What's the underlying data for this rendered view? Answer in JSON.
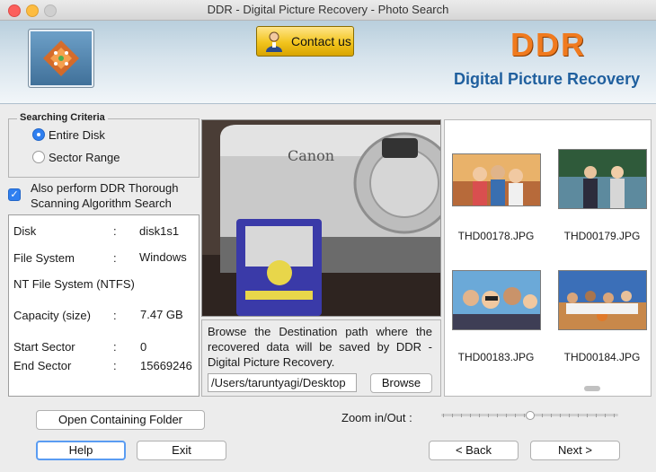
{
  "window": {
    "title": "DDR - Digital Picture Recovery - Photo Search"
  },
  "header": {
    "contact_label": "Contact us",
    "brand_title": "DDR",
    "brand_subtitle": "Digital Picture Recovery"
  },
  "criteria": {
    "legend": "Searching Criteria",
    "options": [
      {
        "label": "Entire Disk",
        "selected": true
      },
      {
        "label": "Sector Range",
        "selected": false
      }
    ]
  },
  "thorough": {
    "label_line1": "Also perform DDR Thorough",
    "label_line2": "Scanning Algorithm Search",
    "checked": true
  },
  "disk_info": {
    "disk_label": "Disk",
    "disk_value": "disk1s1",
    "fs_label": "File System",
    "fs_value": "Windows",
    "fs_full": "NT File System (NTFS)",
    "capacity_label": "Capacity (size)",
    "capacity_value": "7.47  GB",
    "start_label": "Start Sector",
    "start_value": "0",
    "end_label": "End Sector",
    "end_value": "15669246",
    "sep": ":"
  },
  "destination": {
    "instructions": "Browse the Destination path where the recovered data will be saved by DDR - Digital Picture Recovery.",
    "path": "/Users/taruntyagi/Desktop",
    "browse_label": "Browse"
  },
  "thumbnails": [
    {
      "name": "THD00178.JPG"
    },
    {
      "name": "THD00179.JPG"
    },
    {
      "name": "THD00183.JPG"
    },
    {
      "name": "THD00184.JPG"
    }
  ],
  "footer": {
    "open_folder_label": "Open Containing Folder",
    "zoom_label": "Zoom in/Out :",
    "zoom_level": 0.5,
    "help_label": "Help",
    "exit_label": "Exit",
    "back_label": "< Back",
    "next_label": "Next >"
  },
  "colors": {
    "accent": "#2f7ff0",
    "brand_orange": "#f07a1e",
    "brand_blue": "#1f5f9e",
    "contact_gold": "#f2c41d"
  }
}
